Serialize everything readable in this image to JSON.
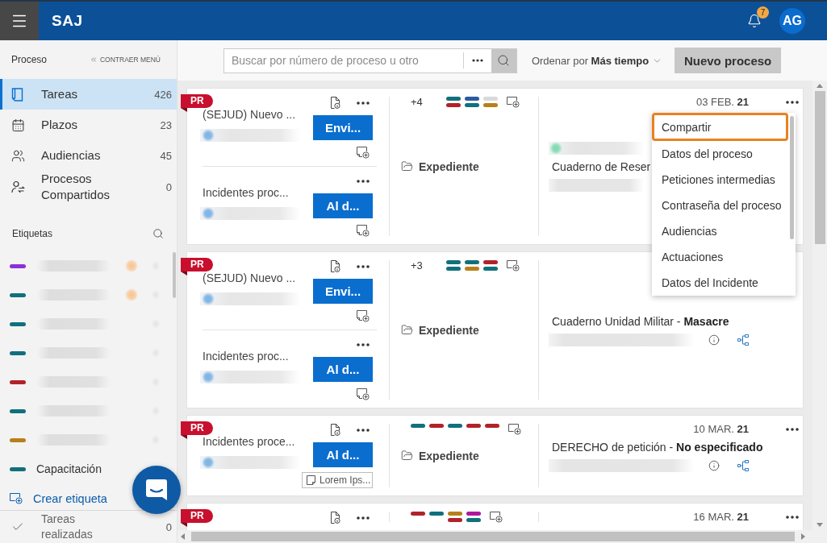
{
  "header": {
    "logo": "SAJ",
    "notification_count": "7",
    "avatar": "AG"
  },
  "sidebar": {
    "title": "Proceso",
    "collapse": "CONTRAER MENÚ",
    "items": [
      {
        "label": "Tareas",
        "count": "426",
        "selected": true
      },
      {
        "label": "Plazos",
        "count": "23",
        "selected": false
      },
      {
        "label": "Audiencias",
        "count": "45",
        "selected": false
      },
      {
        "label": "Procesos Compartidos",
        "count": "0",
        "selected": false
      }
    ],
    "tags_title": "Etiquetas",
    "tags": [
      {
        "kind": "blurred",
        "color": "#8b2fd9",
        "badge": true
      },
      {
        "kind": "blurred",
        "color": "#11707c",
        "badge": true
      },
      {
        "kind": "blurred",
        "color": "#11707c",
        "badge": false
      },
      {
        "kind": "blurred",
        "color": "#11707c",
        "badge": false
      },
      {
        "kind": "blurred",
        "color": "#b22229",
        "badge": false
      },
      {
        "kind": "blurred",
        "color": "#11707c",
        "badge": false
      },
      {
        "kind": "blurred",
        "color": "#b8801a",
        "badge": false
      },
      {
        "kind": "text",
        "color": "#11707c",
        "label": "Capacitación"
      }
    ],
    "create_tag": "Crear etiqueta",
    "completed": {
      "label": "Tareas realizadas",
      "count": "0"
    }
  },
  "toolbar": {
    "search": {
      "placeholder": "Buscar por número de proceso u otro"
    },
    "sort": {
      "label": "Ordenar por",
      "value": "Más tiempo"
    },
    "new_button": "Nuevo proceso"
  },
  "cards": [
    {
      "badge": "PR",
      "tasks": [
        {
          "title": "(SEJUD) Nuevo ...",
          "action": "Envi...",
          "document": true
        },
        {
          "title": "Incidentes proc...",
          "action": "Al d...",
          "document": false
        }
      ],
      "extra_count": "+4",
      "tag_stacks": [
        {
          "tags": [
            {
              "color": "#11707c"
            },
            {
              "color": "#b22229"
            }
          ]
        },
        {
          "tags": [
            {
              "color": "#2c5aa0"
            },
            {
              "color": "#11707c"
            }
          ]
        },
        {
          "tags": [
            {
              "color": "#d9d9d9"
            },
            {
              "color": "#b8801a"
            }
          ]
        }
      ],
      "folder": "Expediente",
      "date": "03 FEB. **21**",
      "more": true,
      "case": {
        "assignee": true,
        "title": "Cuaderno de Reser",
        "links": false
      },
      "menu": {
        "items": [
          {
            "label": "Compartir",
            "selected": true
          },
          {
            "label": "Datos del proceso",
            "selected": false
          },
          {
            "label": "Peticiones intermedias",
            "selected": false
          },
          {
            "label": "Contraseña del proceso",
            "selected": false
          },
          {
            "label": "Audiencias",
            "selected": false
          },
          {
            "label": "Actuaciones",
            "selected": false
          },
          {
            "label": "Datos del Incidente",
            "selected": false
          }
        ]
      }
    },
    {
      "badge": "PR",
      "tasks": [
        {
          "title": "(SEJUD) Nuevo ...",
          "action": "Envi...",
          "document": true
        },
        {
          "title": "Incidentes proc...",
          "action": "Al d...",
          "document": false
        }
      ],
      "extra_count": "+3",
      "tag_stacks": [
        {
          "tags": [
            {
              "color": "#11707c"
            },
            {
              "color": "#11707c"
            }
          ]
        },
        {
          "tags": [
            {
              "color": "#11707c"
            },
            {
              "color": "#b8801a"
            }
          ]
        },
        {
          "tags": [
            {
              "color": "#b22229"
            },
            {
              "color": "#11707c"
            }
          ]
        }
      ],
      "folder": "Expediente",
      "more": false,
      "case": {
        "assignee": false,
        "title": "Cuaderno Unidad Militar - **Masacre**",
        "links": true
      }
    },
    {
      "badge": "PR",
      "tasks": [
        {
          "title": "Incidentes proce...",
          "action": "Al d...",
          "document": true,
          "note": "Lorem Ips..."
        }
      ],
      "tag_stacks": [
        {
          "tags": [
            {
              "color": "#11707c"
            }
          ]
        },
        {
          "tags": [
            {
              "color": "#b22229"
            }
          ]
        },
        {
          "tags": [
            {
              "color": "#11707c"
            }
          ]
        },
        {
          "tags": [
            {
              "color": "#b22229"
            }
          ]
        },
        {
          "tags": [
            {
              "color": "#b22229"
            }
          ]
        }
      ],
      "folder": "Expediente",
      "date": "10 MAR. **21**",
      "more": true,
      "case": {
        "assignee": false,
        "title": "DERECHO de petición - **No especificado**",
        "links": true
      }
    },
    {
      "badge": "PR",
      "tasks": [
        {
          "document": true
        }
      ],
      "tag_stacks": [
        {
          "tags": [
            {
              "color": "#b22229"
            }
          ]
        },
        {
          "tags": [
            {
              "color": "#11707c"
            }
          ]
        },
        {
          "tags": [
            {
              "color": "#b8801a"
            },
            {
              "color": "#b22229"
            }
          ]
        },
        {
          "tags": [
            {
              "color": "#b0169f"
            },
            {
              "color": "#11707c"
            }
          ]
        }
      ],
      "date": "16 MAR. **21**",
      "more": true
    }
  ]
}
